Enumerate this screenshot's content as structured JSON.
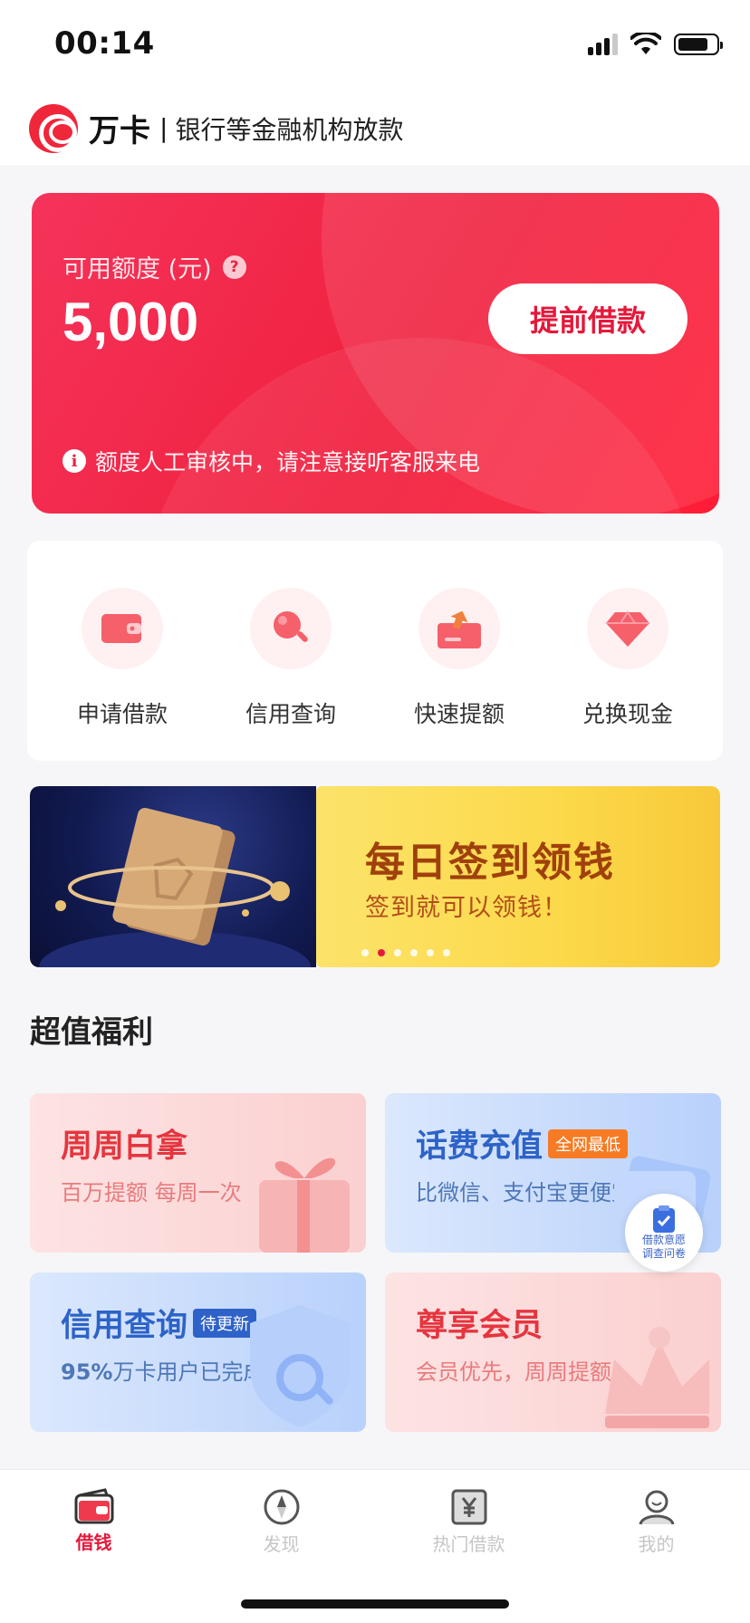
{
  "status_bar": {
    "time": "00:14"
  },
  "header": {
    "brand_name": "万卡",
    "divider": "|",
    "slogan": "银行等金融机构放款"
  },
  "credit_card": {
    "label": "可用额度 (元)",
    "help_icon_glyph": "?",
    "amount": "5,000",
    "advance_button_label": "提前借款",
    "info_icon_glyph": "i",
    "note": "额度人工审核中，请注意接听客服来电",
    "colors": {
      "start": "#f5335a",
      "end": "#ff1c36",
      "button_text": "#e5183a"
    }
  },
  "quick_actions": [
    {
      "label": "申请借款",
      "icon": "wallet-icon"
    },
    {
      "label": "信用查询",
      "icon": "magnifier-icon"
    },
    {
      "label": "快速提额",
      "icon": "upload-card-icon"
    },
    {
      "label": "兑换现金",
      "icon": "diamond-icon"
    }
  ],
  "banner": {
    "title": "每日签到领钱",
    "subtitle": "签到就可以领钱！",
    "active_dot_index": 1,
    "dot_count": 6
  },
  "benefits": {
    "section_title": "超值福利",
    "cards": [
      {
        "title": "周周白拿",
        "subtitle": "百万提额 每周一次"
      },
      {
        "title": "话费充值",
        "tag": "全网最低",
        "subtitle": "比微信、支付宝更便宜"
      },
      {
        "title": "信用查询",
        "tag": "待更新",
        "subtitle_prefix": "95%",
        "subtitle": "万卡用户已完成"
      },
      {
        "title": "尊享会员",
        "subtitle": "会员优先，周周提额"
      }
    ]
  },
  "survey_float": {
    "line1": "借款意愿",
    "line2": "调查问卷"
  },
  "tab_bar": {
    "tabs": [
      {
        "label": "借钱",
        "icon": "wallet-tab-icon",
        "active": true
      },
      {
        "label": "发现",
        "icon": "compass-icon",
        "active": false
      },
      {
        "label": "热门借款",
        "icon": "yen-note-icon",
        "active": false
      },
      {
        "label": "我的",
        "icon": "user-icon",
        "active": false
      }
    ],
    "active_color": "#e5183a",
    "inactive_color": "#c6c6c6"
  }
}
